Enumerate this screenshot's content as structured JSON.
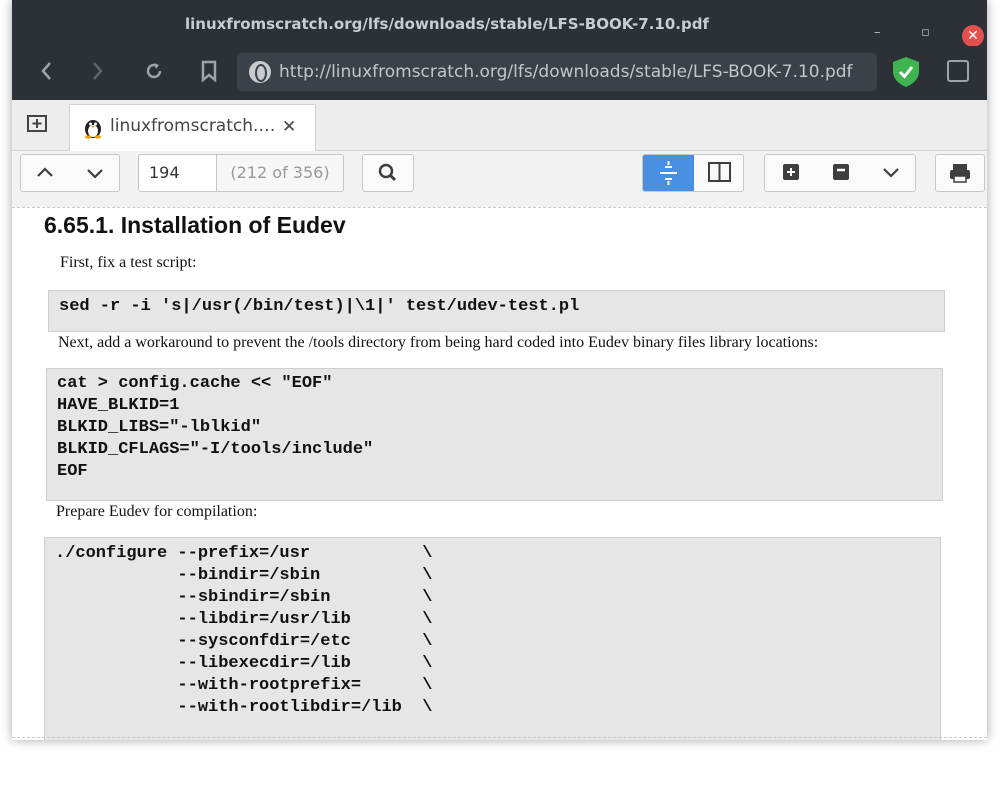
{
  "window": {
    "title": "linuxfromscratch.org/lfs/downloads/stable/LFS-BOOK-7.10.pdf",
    "minimize": "–",
    "maximize": "▫",
    "close": "✕"
  },
  "nav": {
    "url": "http://linuxfromscratch.org/lfs/downloads/stable/LFS-BOOK-7.10.pdf"
  },
  "tab": {
    "title": "linuxfromscratch.…",
    "close": "✕"
  },
  "toolbar": {
    "page_number": "194",
    "page_count": "(212 of 356)"
  },
  "document": {
    "heading": "6.65.1. Installation of Eudev",
    "para1": "First, fix a test script:",
    "code1": "sed -r -i 's|/usr(/bin/test)|\\1|' test/udev-test.pl",
    "para2": "Next, add a workaround to prevent the /tools directory from being hard coded into Eudev binary files library locations:",
    "code2": "cat > config.cache << \"EOF\"\nHAVE_BLKID=1\nBLKID_LIBS=\"-lblkid\"\nBLKID_CFLAGS=\"-I/tools/include\"\nEOF",
    "para3": "Prepare Eudev for compilation:",
    "code3": "./configure --prefix=/usr           \\\n            --bindir=/sbin          \\\n            --sbindir=/sbin         \\\n            --libdir=/usr/lib       \\\n            --sysconfdir=/etc       \\\n            --libexecdir=/lib       \\\n            --with-rootprefix=      \\\n            --with-rootlibdir=/lib  \\"
  },
  "colors": {
    "chrome": "#2b3137",
    "url_bg": "#3a4148",
    "active_button": "#4a90e2",
    "close_button": "#e2514d",
    "code_bg": "#e6e6e6"
  }
}
